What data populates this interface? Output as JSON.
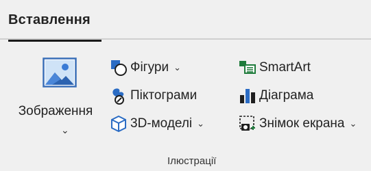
{
  "ribbon": {
    "tab_label": "Вставлення",
    "group_name": "Ілюстрації",
    "big_button": {
      "label": "Зображення",
      "icon": "picture-icon"
    },
    "items": [
      {
        "label": "Фігури",
        "icon": "shapes-icon",
        "has_dropdown": true
      },
      {
        "label": "Піктограми",
        "icon": "icons-icon",
        "has_dropdown": false
      },
      {
        "label": "3D-моделі",
        "icon": "3d-model-icon",
        "has_dropdown": true
      },
      {
        "label": "SmartArt",
        "icon": "smartart-icon",
        "has_dropdown": false
      },
      {
        "label": "Діаграма",
        "icon": "chart-icon",
        "has_dropdown": false
      },
      {
        "label": "Знімок екрана",
        "icon": "screenshot-icon",
        "has_dropdown": true
      }
    ]
  },
  "colors": {
    "accent_blue": "#2b6cc4",
    "accent_green": "#1e7b3b",
    "background": "#f0f0f0"
  }
}
